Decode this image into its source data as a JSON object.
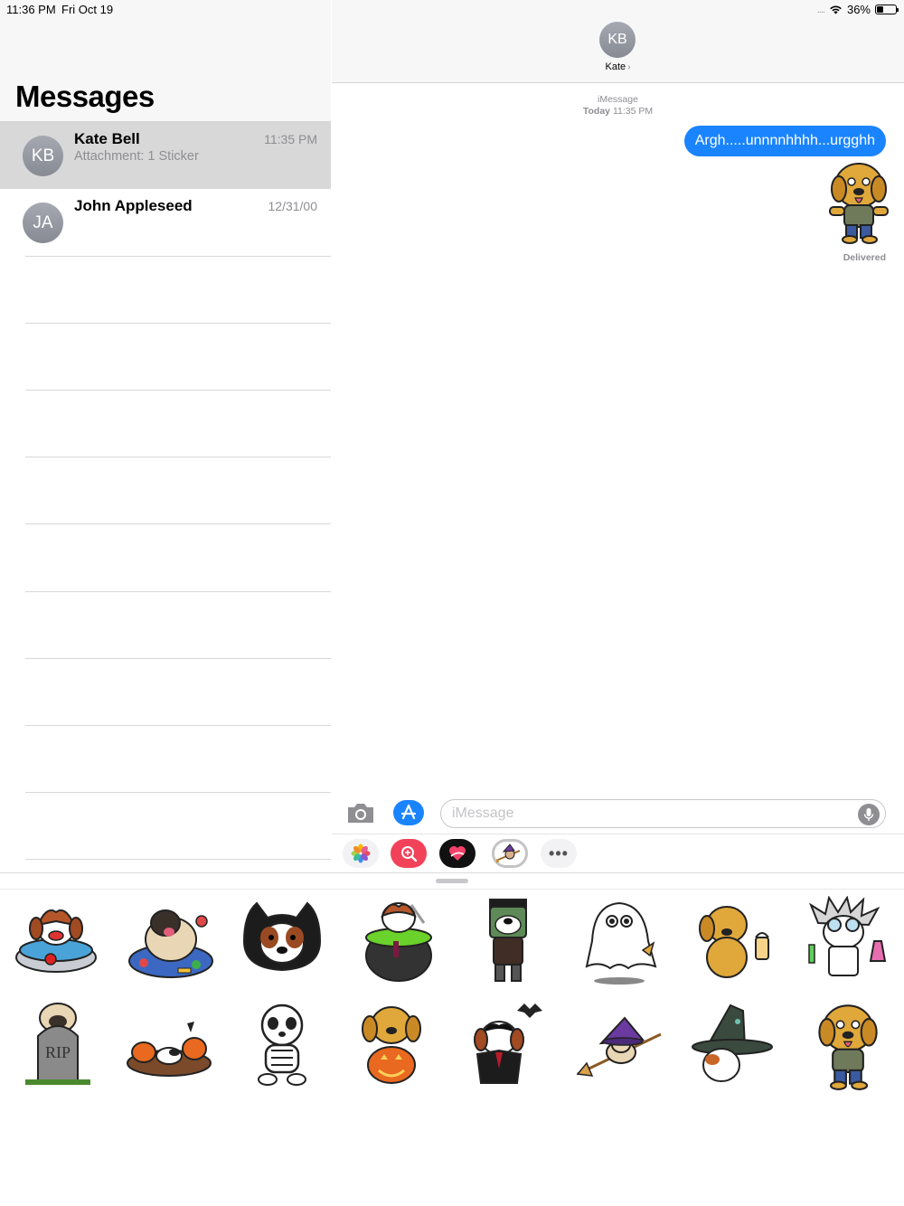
{
  "status_bar": {
    "time": "11:36 PM",
    "date": "Fri Oct 19",
    "signal": "....",
    "battery_percent_label": "36%",
    "battery_level": 0.36
  },
  "sidebar": {
    "title": "Messages",
    "conversations": [
      {
        "initials": "KB",
        "name": "Kate Bell",
        "time": "11:35 PM",
        "preview": "Attachment: 1 Sticker",
        "selected": true
      },
      {
        "initials": "JA",
        "name": "John Appleseed",
        "time": "12/31/00",
        "preview": "",
        "selected": false
      }
    ]
  },
  "chat": {
    "contact_initials": "KB",
    "contact_name": "Kate",
    "service": "iMessage",
    "day": "Today",
    "time": "11:35 PM",
    "message_text": "Argh.....unnnnhhhh...urgghh",
    "sticker": "zombie-dog-sticker",
    "status": "Delivered"
  },
  "composer": {
    "placeholder": "iMessage"
  },
  "app_drawer": {
    "apps": [
      "photos-app-icon",
      "image-search-app-icon",
      "digital-touch-app-icon",
      "sticker-pack-app-icon",
      "more-apps-icon"
    ],
    "more_label": "•••"
  },
  "sticker_tray": {
    "stickers": [
      "dog-in-apple-bobbing-tub",
      "pug-in-candy-pile",
      "dog-in-black-cat-mask",
      "dog-in-witch-cauldron",
      "frankenstein-dog",
      "ghost-dog",
      "dog-with-lantern",
      "mad-scientist-dog",
      "pug-behind-rip-tombstone",
      "dog-in-pumpkin-patch",
      "skeleton-dog",
      "dog-with-jack-o-lantern",
      "vampire-dog-with-bat",
      "pug-on-witch-broom",
      "dog-in-witch-hat",
      "zombie-dog"
    ]
  },
  "colors": {
    "imessage_blue": "#1a84ff",
    "avatar_gray": "#8e8e93",
    "selected_row": "#d8d8d8"
  }
}
